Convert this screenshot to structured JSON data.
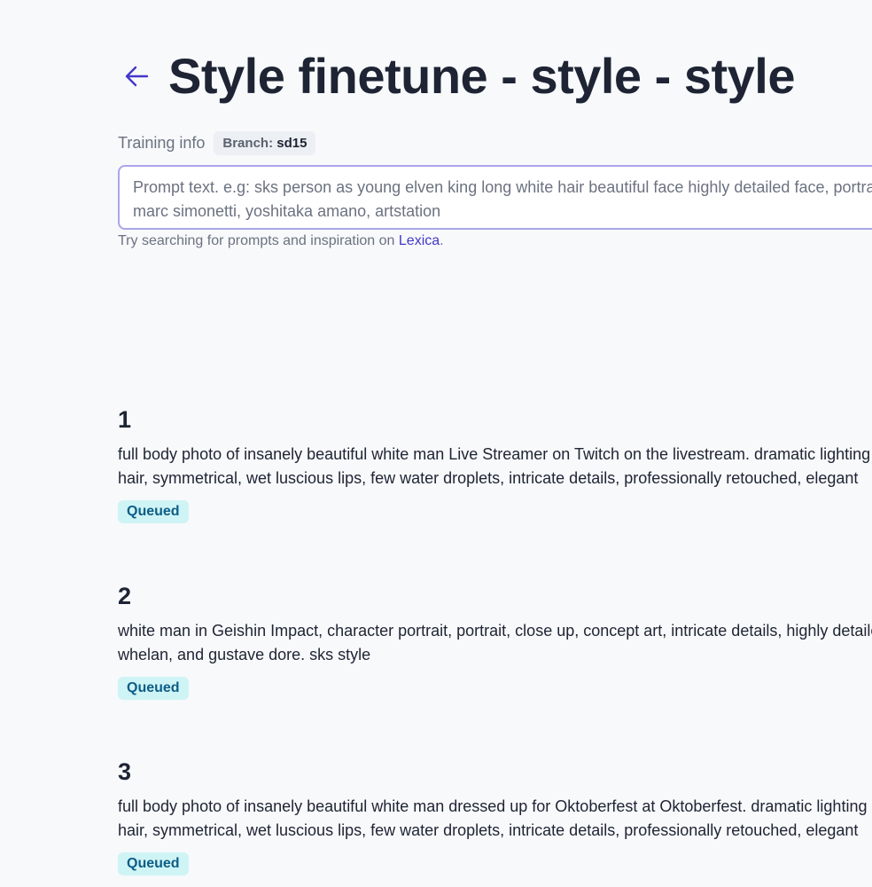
{
  "header": {
    "title": "Style finetune - style - style",
    "back_icon": "arrow-left-icon"
  },
  "training": {
    "label": "Training info",
    "branch_key": "Branch:",
    "branch_value": "sd15"
  },
  "prompt": {
    "placeholder": "Prompt text. e.g: sks person as young elven king long white hair beautiful face highly detailed face, portrait\nmarc simonetti, yoshitaka amano, artstation"
  },
  "hint": {
    "text": "Try searching for prompts and inspiration on ",
    "link": "Lexica",
    "suffix": "."
  },
  "colors": {
    "accent": "#4338ca",
    "status_bg": "#cff4f6",
    "status_text": "#0d5d86"
  },
  "prompts": [
    {
      "number": "1",
      "text": "full body photo of insanely beautiful white man Live Streamer on Twitch on the livestream. dramatic lighting\nhair, symmetrical, wet luscious lips, few water droplets, intricate details, professionally retouched, elegant",
      "status": "Queued"
    },
    {
      "number": "2",
      "text": "white man in Geishin Impact, character portrait, portrait, close up, concept art, intricate details, highly detailed\nwhelan, and gustave dore. sks style",
      "status": "Queued"
    },
    {
      "number": "3",
      "text": "full body photo of insanely beautiful white man dressed up for Oktoberfest at Oktoberfest. dramatic lighting\nhair, symmetrical, wet luscious lips, few water droplets, intricate details, professionally retouched, elegant",
      "status": "Queued"
    }
  ]
}
